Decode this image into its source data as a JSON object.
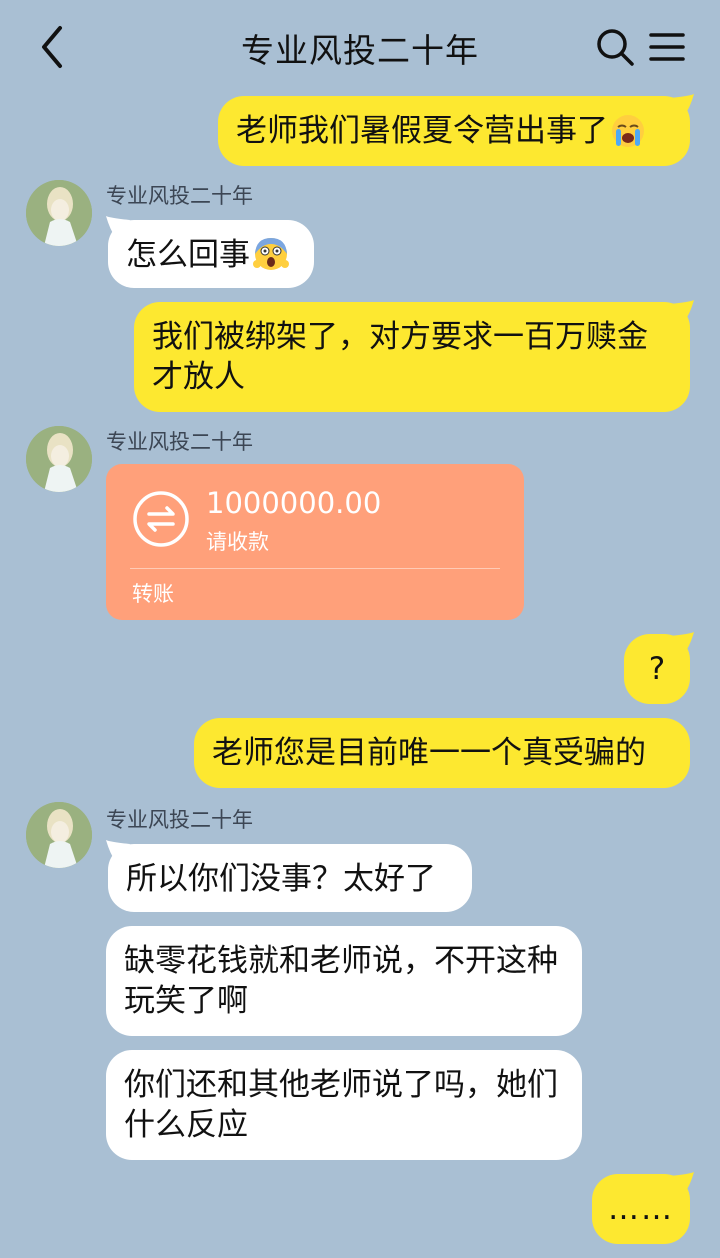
{
  "header": {
    "title": "专业风投二十年",
    "back_icon": "chevron-left-icon",
    "search_icon": "search-icon",
    "menu_icon": "menu-icon"
  },
  "colors": {
    "background": "#a9bfd3",
    "my_bubble": "#fde830",
    "their_bubble": "#ffffff",
    "transfer_card": "#ffa07a"
  },
  "messages": [
    {
      "from": "me",
      "text": "老师我们暑假夏令营出事了",
      "emoji": "loudly-crying-face"
    },
    {
      "from": "them",
      "sender": "专业风投二十年",
      "text": "怎么回事",
      "emoji": "face-screaming-in-fear"
    },
    {
      "from": "me",
      "text": "我们被绑架了，对方要求一百万赎金才放人"
    },
    {
      "from": "them",
      "sender": "专业风投二十年",
      "type": "transfer",
      "amount": "1000000.00",
      "subtitle": "请收款",
      "footer": "转账"
    },
    {
      "from": "me",
      "text": "?"
    },
    {
      "from": "me",
      "text": "老师您是目前唯一一个真受骗的"
    },
    {
      "from": "them",
      "sender": "专业风投二十年",
      "text": "所以你们没事？太好了"
    },
    {
      "from": "them",
      "text": "缺零花钱就和老师说，不开这种玩笑了啊"
    },
    {
      "from": "them",
      "text": "你们还和其他老师说了吗，她们什么反应"
    },
    {
      "from": "me",
      "text": "……"
    }
  ]
}
